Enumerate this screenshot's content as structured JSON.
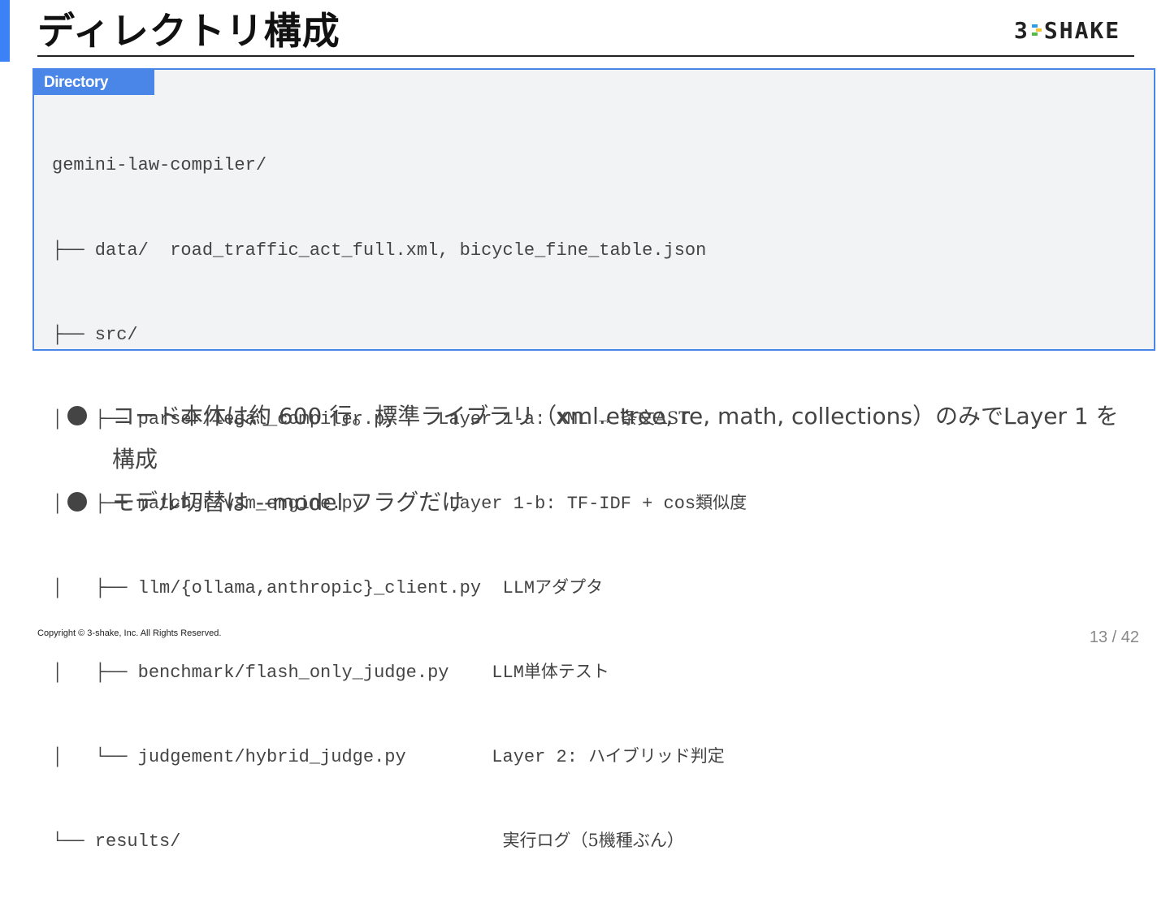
{
  "slide": {
    "title": "ディレクトリ構成",
    "logo": {
      "text_left": "3",
      "text_right": "SHAKE",
      "colors": [
        "#2e9be6",
        "#f2c230",
        "#56b947"
      ]
    },
    "accent_color": "#3b82f6"
  },
  "directory": {
    "label": "Directory",
    "lines": [
      {
        "tree": "gemini-law-compiler/",
        "note": ""
      },
      {
        "tree": "├── data/  road_traffic_act_full.xml, bicycle_fine_table.json",
        "note": ""
      },
      {
        "tree": "├── src/",
        "note": ""
      },
      {
        "tree": "│   ├── parser/legal_compiler.py    Layer 1-a: XML → ",
        "note": "条文AST"
      },
      {
        "tree": "│   ├── matcher/vsm_engine.py        Layer 1-b: TF-IDF + cos",
        "note": "類似度"
      },
      {
        "tree": "│   ├── llm/{ollama,anthropic}_client.py  LLM",
        "note": "アダプタ"
      },
      {
        "tree": "│   ├── benchmark/flash_only_judge.py    LLM",
        "note": "単体テスト"
      },
      {
        "tree": "│   └── judgement/hybrid_judge.py        Layer 2: ",
        "note": "ハイブリッド判定"
      },
      {
        "tree": "└── results/                              ",
        "note": "実行ログ（5機種ぶん）"
      }
    ]
  },
  "bullets": [
    {
      "text": "コード本体は約 600 行。標準ライブラリ（xml.etree, re, math, collections）のみでLayer 1 を構成"
    },
    {
      "text": "モデル切替は --model フラグだけ"
    }
  ],
  "footer": {
    "copyright": "Copyright © 3-shake, Inc. All Rights Reserved.",
    "page": "13 / 42"
  }
}
